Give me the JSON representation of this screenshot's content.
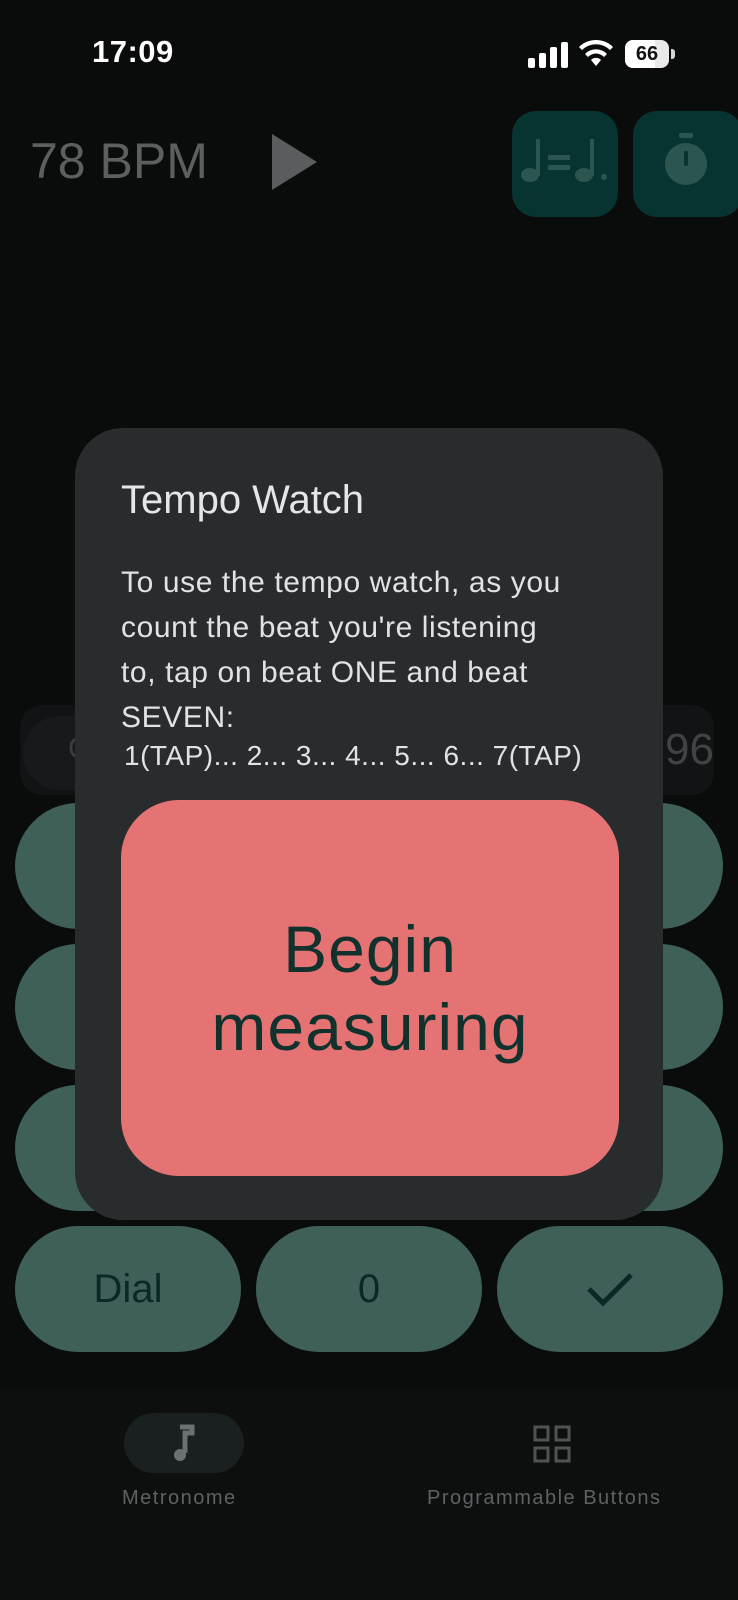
{
  "status_bar": {
    "time": "17:09",
    "battery": "66"
  },
  "header": {
    "bpm_label": "78 BPM",
    "play_icon": "play-icon",
    "note_button_icon": "note-equals-dotted-note-icon",
    "timer_button_icon": "stopwatch-icon"
  },
  "field": {
    "chip_text": "C",
    "value": "96"
  },
  "keypad": {
    "dial_label": "Dial",
    "zero_label": "0",
    "confirm_icon": "check-icon"
  },
  "dialog": {
    "title": "Tempo Watch",
    "body": "To use the tempo watch, as you\ncount the beat you're listening\nto, tap on beat ONE and beat\nSEVEN:",
    "sequence": "1(TAP)... 2... 3... 4... 5... 6... 7(TAP)",
    "begin_button": "Begin\nmeasuring"
  },
  "nav": {
    "items": [
      {
        "label": "Metronome",
        "icon": "music-note-icon",
        "selected": true
      },
      {
        "label": "Programmable Buttons",
        "icon": "grid-icon",
        "selected": false
      }
    ]
  },
  "colors": {
    "accent_button": "#e57373",
    "keypad": "#3f5f59",
    "dialog_surface": "#292c2d",
    "header_button": "#073430"
  }
}
